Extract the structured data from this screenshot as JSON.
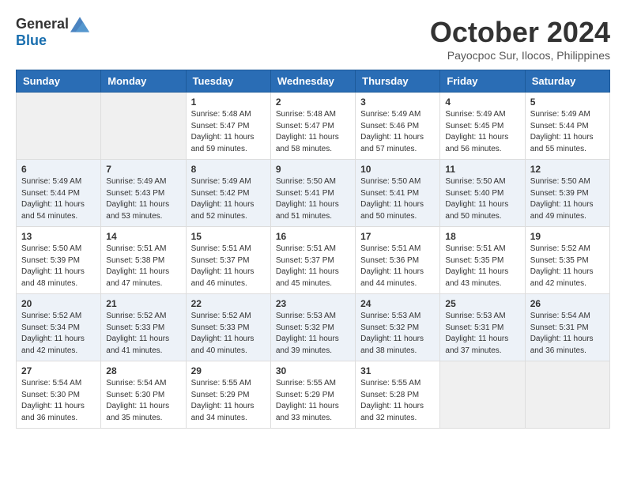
{
  "header": {
    "logo": {
      "general": "General",
      "blue": "Blue"
    },
    "title": "October 2024",
    "location": "Payocpoc Sur, Ilocos, Philippines"
  },
  "weekdays": [
    "Sunday",
    "Monday",
    "Tuesday",
    "Wednesday",
    "Thursday",
    "Friday",
    "Saturday"
  ],
  "weeks": [
    [
      {
        "day": "",
        "info": ""
      },
      {
        "day": "",
        "info": ""
      },
      {
        "day": "1",
        "info": "Sunrise: 5:48 AM\nSunset: 5:47 PM\nDaylight: 11 hours\nand 59 minutes."
      },
      {
        "day": "2",
        "info": "Sunrise: 5:48 AM\nSunset: 5:47 PM\nDaylight: 11 hours\nand 58 minutes."
      },
      {
        "day": "3",
        "info": "Sunrise: 5:49 AM\nSunset: 5:46 PM\nDaylight: 11 hours\nand 57 minutes."
      },
      {
        "day": "4",
        "info": "Sunrise: 5:49 AM\nSunset: 5:45 PM\nDaylight: 11 hours\nand 56 minutes."
      },
      {
        "day": "5",
        "info": "Sunrise: 5:49 AM\nSunset: 5:44 PM\nDaylight: 11 hours\nand 55 minutes."
      }
    ],
    [
      {
        "day": "6",
        "info": "Sunrise: 5:49 AM\nSunset: 5:44 PM\nDaylight: 11 hours\nand 54 minutes."
      },
      {
        "day": "7",
        "info": "Sunrise: 5:49 AM\nSunset: 5:43 PM\nDaylight: 11 hours\nand 53 minutes."
      },
      {
        "day": "8",
        "info": "Sunrise: 5:49 AM\nSunset: 5:42 PM\nDaylight: 11 hours\nand 52 minutes."
      },
      {
        "day": "9",
        "info": "Sunrise: 5:50 AM\nSunset: 5:41 PM\nDaylight: 11 hours\nand 51 minutes."
      },
      {
        "day": "10",
        "info": "Sunrise: 5:50 AM\nSunset: 5:41 PM\nDaylight: 11 hours\nand 50 minutes."
      },
      {
        "day": "11",
        "info": "Sunrise: 5:50 AM\nSunset: 5:40 PM\nDaylight: 11 hours\nand 50 minutes."
      },
      {
        "day": "12",
        "info": "Sunrise: 5:50 AM\nSunset: 5:39 PM\nDaylight: 11 hours\nand 49 minutes."
      }
    ],
    [
      {
        "day": "13",
        "info": "Sunrise: 5:50 AM\nSunset: 5:39 PM\nDaylight: 11 hours\nand 48 minutes."
      },
      {
        "day": "14",
        "info": "Sunrise: 5:51 AM\nSunset: 5:38 PM\nDaylight: 11 hours\nand 47 minutes."
      },
      {
        "day": "15",
        "info": "Sunrise: 5:51 AM\nSunset: 5:37 PM\nDaylight: 11 hours\nand 46 minutes."
      },
      {
        "day": "16",
        "info": "Sunrise: 5:51 AM\nSunset: 5:37 PM\nDaylight: 11 hours\nand 45 minutes."
      },
      {
        "day": "17",
        "info": "Sunrise: 5:51 AM\nSunset: 5:36 PM\nDaylight: 11 hours\nand 44 minutes."
      },
      {
        "day": "18",
        "info": "Sunrise: 5:51 AM\nSunset: 5:35 PM\nDaylight: 11 hours\nand 43 minutes."
      },
      {
        "day": "19",
        "info": "Sunrise: 5:52 AM\nSunset: 5:35 PM\nDaylight: 11 hours\nand 42 minutes."
      }
    ],
    [
      {
        "day": "20",
        "info": "Sunrise: 5:52 AM\nSunset: 5:34 PM\nDaylight: 11 hours\nand 42 minutes."
      },
      {
        "day": "21",
        "info": "Sunrise: 5:52 AM\nSunset: 5:33 PM\nDaylight: 11 hours\nand 41 minutes."
      },
      {
        "day": "22",
        "info": "Sunrise: 5:52 AM\nSunset: 5:33 PM\nDaylight: 11 hours\nand 40 minutes."
      },
      {
        "day": "23",
        "info": "Sunrise: 5:53 AM\nSunset: 5:32 PM\nDaylight: 11 hours\nand 39 minutes."
      },
      {
        "day": "24",
        "info": "Sunrise: 5:53 AM\nSunset: 5:32 PM\nDaylight: 11 hours\nand 38 minutes."
      },
      {
        "day": "25",
        "info": "Sunrise: 5:53 AM\nSunset: 5:31 PM\nDaylight: 11 hours\nand 37 minutes."
      },
      {
        "day": "26",
        "info": "Sunrise: 5:54 AM\nSunset: 5:31 PM\nDaylight: 11 hours\nand 36 minutes."
      }
    ],
    [
      {
        "day": "27",
        "info": "Sunrise: 5:54 AM\nSunset: 5:30 PM\nDaylight: 11 hours\nand 36 minutes."
      },
      {
        "day": "28",
        "info": "Sunrise: 5:54 AM\nSunset: 5:30 PM\nDaylight: 11 hours\nand 35 minutes."
      },
      {
        "day": "29",
        "info": "Sunrise: 5:55 AM\nSunset: 5:29 PM\nDaylight: 11 hours\nand 34 minutes."
      },
      {
        "day": "30",
        "info": "Sunrise: 5:55 AM\nSunset: 5:29 PM\nDaylight: 11 hours\nand 33 minutes."
      },
      {
        "day": "31",
        "info": "Sunrise: 5:55 AM\nSunset: 5:28 PM\nDaylight: 11 hours\nand 32 minutes."
      },
      {
        "day": "",
        "info": ""
      },
      {
        "day": "",
        "info": ""
      }
    ]
  ]
}
